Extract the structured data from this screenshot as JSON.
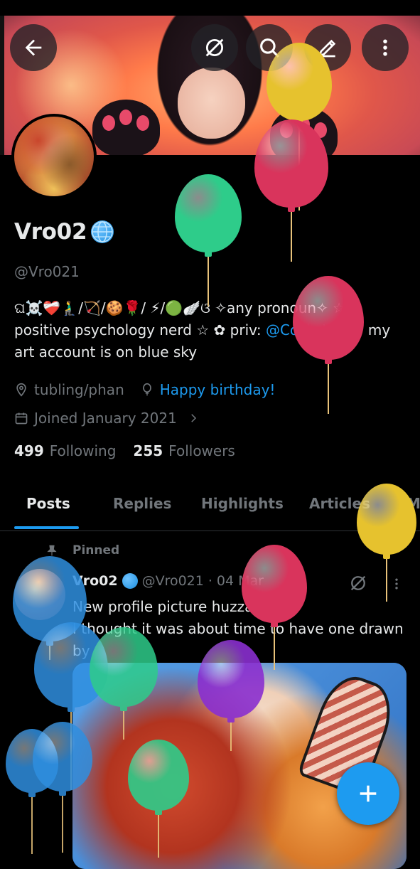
{
  "profile": {
    "display_name": "Vro02",
    "handle": "@Vro021",
    "bio_line1": "ଘ☠️❤️‍🩹🧎‍♂️/🏹/🍪🌹/ ⚡/🟢🪽ଓ ✧any pronoun✧ ☆",
    "bio_line2_pre": "positive psychology nerd ☆ ✿ priv: ",
    "bio_mention": "@CockaVro",
    "bio_line2_post": " ✿ my",
    "bio_line3": "art account is on blue sky",
    "location": "tubling/phan",
    "birthday": "Happy birthday!",
    "joined": "Joined January 2021",
    "following_count": "499",
    "following_label": "Following",
    "followers_count": "255",
    "followers_label": "Followers"
  },
  "tabs": [
    "Posts",
    "Replies",
    "Highlights",
    "Articles",
    "M"
  ],
  "active_tab": "Posts",
  "post": {
    "pinned_label": "Pinned",
    "author_name": "Vro02",
    "author_handle": "@Vro021",
    "separator": "·",
    "date": "04 Mar",
    "text_line1": "New profile picture huzzah",
    "text_line2": "I thought it was about time to have one drawn",
    "text_line3": "by"
  },
  "icons": {
    "back": "arrow-left-icon",
    "grok": "grok-icon",
    "search": "search-icon",
    "edit": "edit-icon",
    "more": "more-vertical-icon",
    "location": "location-pin-icon",
    "balloon": "balloon-icon",
    "calendar": "calendar-icon",
    "compose": "plus-icon"
  },
  "colors": {
    "accent": "#1d9bf0",
    "text_primary": "#e7e9ea",
    "text_secondary": "#71767b",
    "balloon_yellow": "#e6c22e",
    "balloon_red": "#d9345c",
    "balloon_green": "#2ecc8a",
    "balloon_blue": "#2f8fe0",
    "balloon_purple": "#8a2fd0"
  }
}
